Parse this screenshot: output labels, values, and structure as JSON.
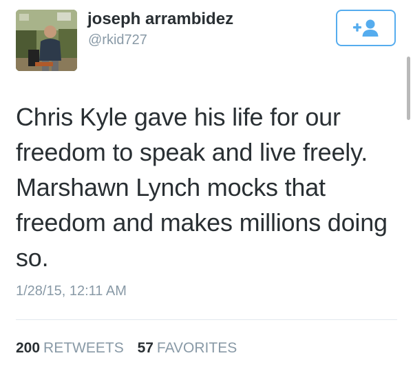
{
  "user": {
    "display_name": "joseph arrambidez",
    "handle": "@rkid727"
  },
  "follow_button": {
    "icon": "add-user-icon"
  },
  "tweet": {
    "text": "Chris Kyle gave his life for our freedom to speak and live freely. Marshawn Lynch mocks that freedom and makes millions doing so.",
    "timestamp": "1/28/15, 12:11 AM"
  },
  "stats": {
    "retweets_count": "200",
    "retweets_label": "RETWEETS",
    "favorites_count": "57",
    "favorites_label": "FAVORITES"
  },
  "colors": {
    "accent": "#55acee",
    "text": "#292f33",
    "muted": "#8899a6",
    "divider": "#e1e8ed"
  }
}
